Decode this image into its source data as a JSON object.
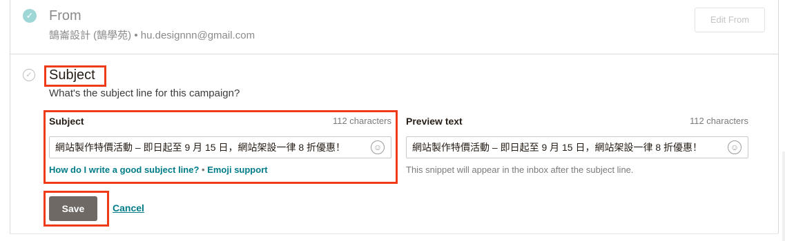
{
  "from": {
    "title": "From",
    "detail": "鵠崙設計 (鵠學苑) • hu.designnn@gmail.com",
    "edit_label": "Edit From",
    "check_icon": "✓"
  },
  "subject_section": {
    "title": "Subject",
    "question": "What's the subject line for this campaign?",
    "check_icon": "✓"
  },
  "subject_field": {
    "label": "Subject",
    "count": "112 characters",
    "value": "網站製作特價活動 – 即日起至 9 月 15 日，網站架設一律 8 折優惠！",
    "emoji_icon": "☺"
  },
  "preview_field": {
    "label": "Preview text",
    "count": "112 characters",
    "value": "網站製作特價活動 – 即日起至 9 月 15 日，網站架設一律 8 折優惠！",
    "emoji_icon": "☺",
    "helper": "This snippet will appear in the inbox after the subject line."
  },
  "help": {
    "subject_help": "How do I write a good subject line?",
    "separator": " • ",
    "emoji_support": "Emoji support"
  },
  "actions": {
    "save_label": "Save",
    "cancel_label": "Cancel"
  },
  "colors": {
    "highlight": "#ee3a17",
    "link": "#007c89",
    "save_button": "#6e6964"
  }
}
